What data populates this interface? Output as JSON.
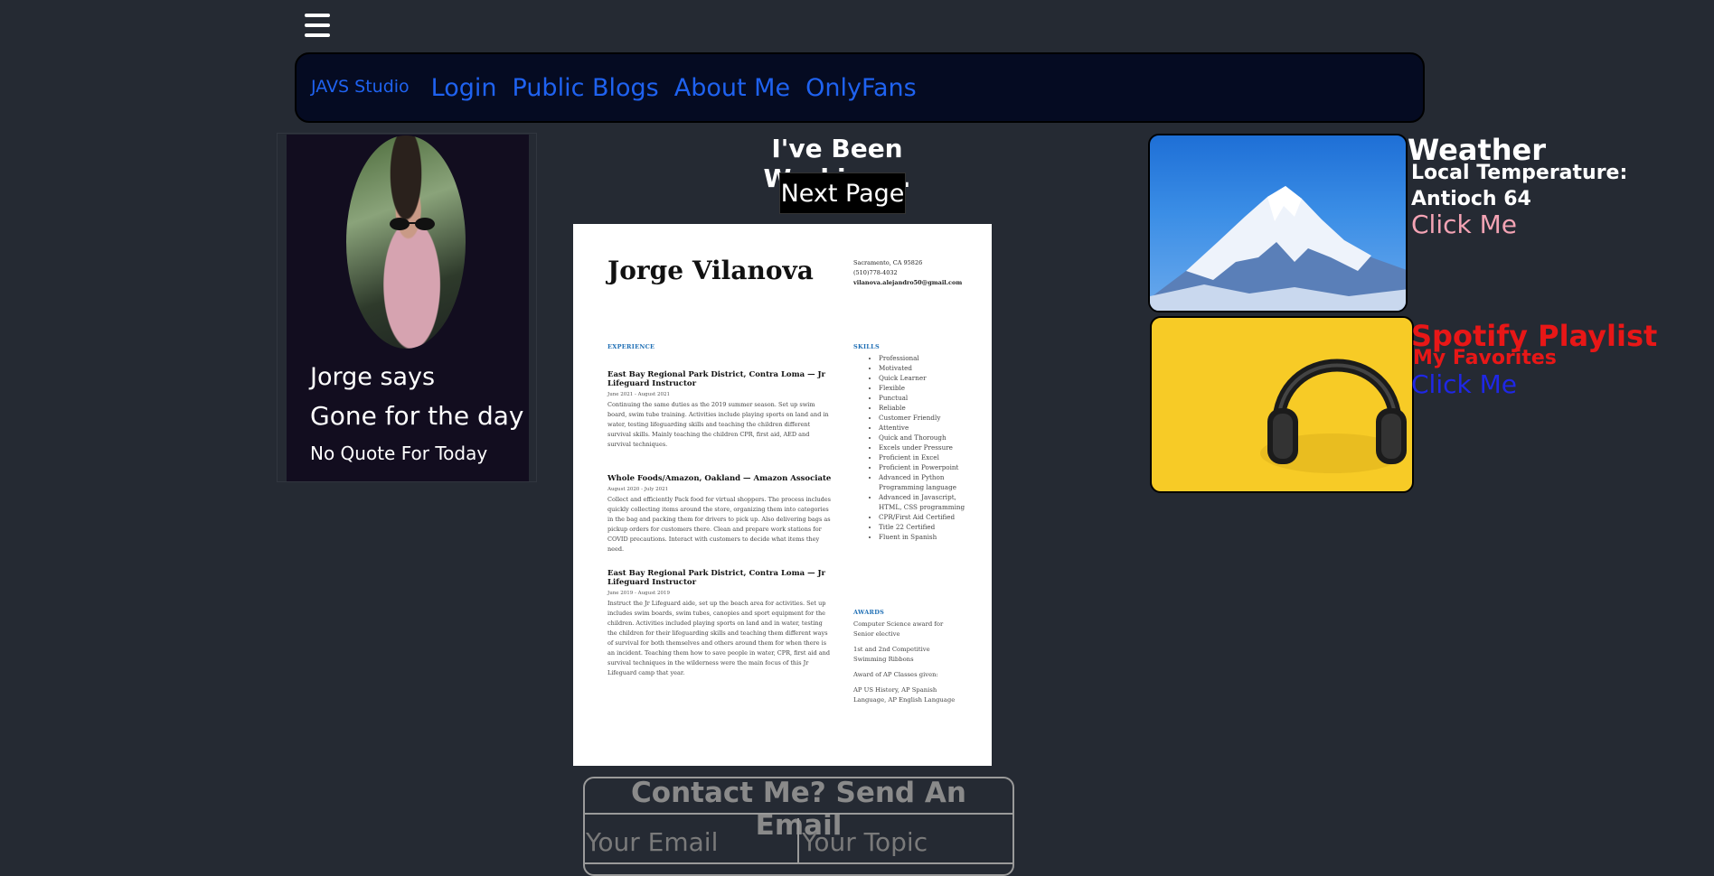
{
  "nav": {
    "brand": "JAVS Studio",
    "links": [
      "Login",
      "Public Blogs",
      "About Me",
      "OnlyFans"
    ]
  },
  "profile": {
    "says": "Jorge says",
    "status": "Gone for the day",
    "quote": "No Quote For Today"
  },
  "work": {
    "title": "I've Been Working...",
    "next_label": "Next Page"
  },
  "resume": {
    "name": "Jorge Vilanova",
    "contact": [
      "Sacramento, CA 95826",
      "(510)778-4032",
      "vilanova.alejandro50@gmail.com"
    ],
    "experience_heading": "EXPERIENCE",
    "skills_heading": "SKILLS",
    "awards_heading": "AWARDS",
    "jobs": [
      {
        "title": "East Bay Regional Park District, Contra Loma — Jr Lifeguard Instructor",
        "dates": "June 2021 - August 2021",
        "desc": "Continuing the same duties as the 2019 summer season. Set up swim board, swim tube training. Activities include playing sports on land and in water, testing lifeguarding skills and teaching the children different survival skills. Mainly teaching the children CPR, first aid, AED and survival techniques."
      },
      {
        "title": "Whole Foods/Amazon, Oakland — Amazon Associate",
        "dates": "August 2020 - July 2021",
        "desc": "Collect and efficiently Pack food for virtual shoppers. The process includes quickly collecting items around the store, organizing them into categories in the bag and packing them for drivers to pick up. Also delivering bags as pickup orders for customers there. Clean and prepare work stations for COVID precautions. Interact with customers to decide what items they need."
      },
      {
        "title": "East Bay Regional Park District, Contra Loma — Jr Lifeguard Instructor",
        "dates": "June 2019 - August 2019",
        "desc": "Instruct the Jr Lifeguard aide, set up the beach area for activities. Set up includes swim boards, swim tubes, canopies and sport equipment for the children. Activities included playing sports on land and in water, testing the children for their lifeguarding skills and teaching them different ways of survival for both themselves and others around them for when there is an incident. Teaching them how to save people in water, CPR, first aid and survival techniques in the wilderness were the main focus of this Jr Lifeguard camp that year."
      }
    ],
    "skills": [
      "Professional",
      "Motivated",
      "Quick Learner",
      "Flexible",
      "Punctual",
      "Reliable",
      "Customer Friendly",
      "Attentive",
      "Quick and Thorough",
      "Excels under Pressure",
      "Proficient in Excel",
      "Proficient in Powerpoint",
      "Advanced in Python Programming language",
      "Advanced in Javascript, HTML, CSS programming",
      "CPR/First Aid Certified",
      "Title 22 Certified",
      "Fluent in Spanish"
    ],
    "awards": [
      "Computer Science award for Senior elective",
      "1st and 2nd Competitive Swimming Ribbons",
      "Award of AP Classes given:",
      "AP US History, AP Spanish Language, AP English Language"
    ]
  },
  "contact": {
    "title": "Contact Me? Send An Email",
    "email_placeholder": "Your Email",
    "topic_placeholder": "Your Topic"
  },
  "weather": {
    "title": "Weather",
    "temp_label": "Local Temperature:",
    "reading": "Antioch 64",
    "link": "Click Me"
  },
  "spotify": {
    "title": "Spotify Playlist",
    "subtitle": "My Favorites",
    "link": "Click Me"
  }
}
